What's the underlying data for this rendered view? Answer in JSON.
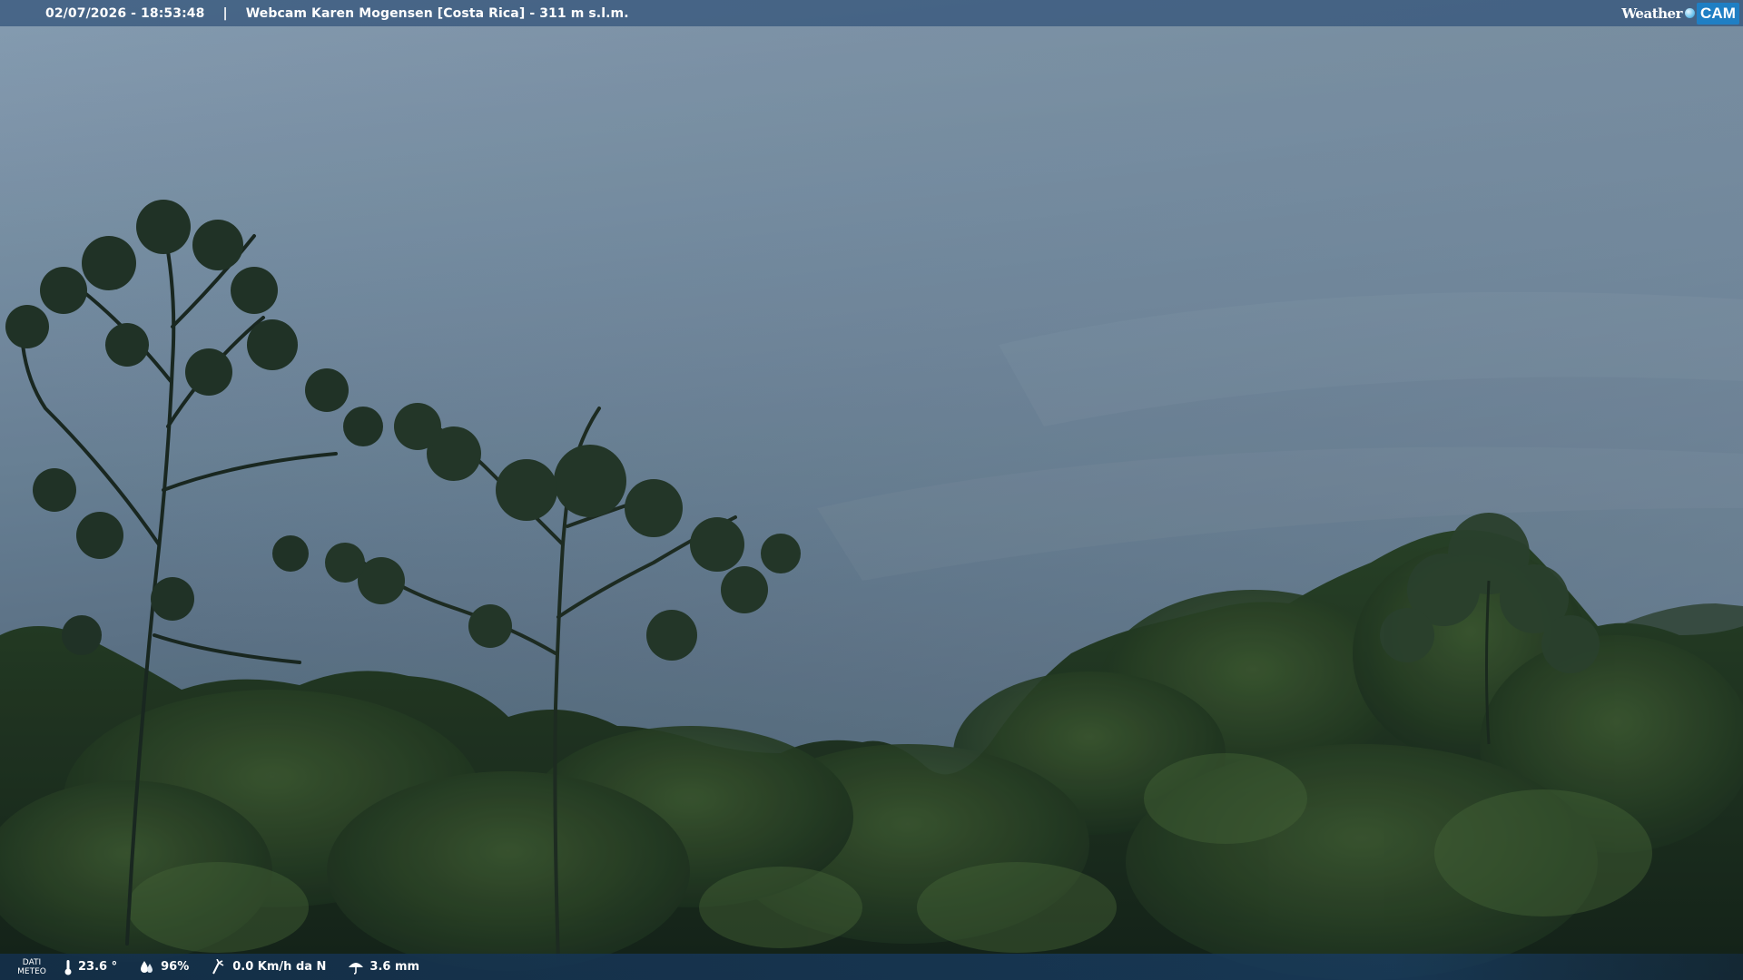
{
  "header": {
    "datetime": "02/07/2026 - 18:53:48",
    "separator": "|",
    "title": "Webcam Karen Mogensen [Costa Rica]  - 311 m s.l.m."
  },
  "brand": {
    "weather": "Weather",
    "cam": "CAM"
  },
  "footer": {
    "label_line1": "DATI",
    "label_line2": "METEO",
    "temperature": "23.6 °",
    "humidity": "96%",
    "wind": "0.0 Km/h da N",
    "rain": "3.6 mm"
  },
  "icons": {
    "temperature": "thermometer-icon",
    "humidity": "humidity-drop-icon",
    "wind": "wind-icon",
    "rain": "rain-umbrella-icon"
  },
  "colors": {
    "sky_top": "#8fa6bb",
    "sky_bottom": "#4e6478",
    "forest": "#1e3320",
    "topbar": "#305278",
    "bottombar": "#14304c",
    "brand_accent": "#1f7fc4"
  }
}
